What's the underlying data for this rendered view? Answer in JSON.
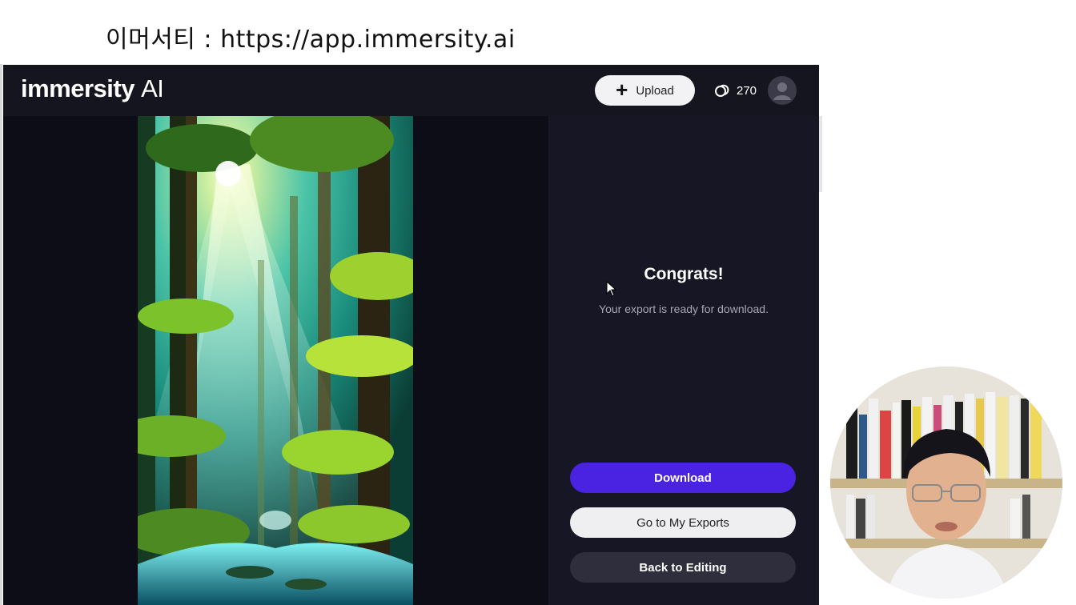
{
  "caption": "이머서티 : https://app.immersity.ai",
  "header": {
    "logo_main": "immersity",
    "logo_ai": "AI",
    "upload_label": "Upload",
    "credits": "270"
  },
  "export_panel": {
    "title": "Congrats!",
    "message": "Your export is ready for download.",
    "download_label": "Download",
    "exports_label": "Go to My Exports",
    "back_label": "Back to Editing"
  },
  "icons": {
    "upload": "plus-icon",
    "credits": "credits-coin-icon",
    "avatar": "user-avatar-icon"
  },
  "colors": {
    "accent": "#4a22e2",
    "app_background": "#111222",
    "panel_background": "#161624"
  }
}
